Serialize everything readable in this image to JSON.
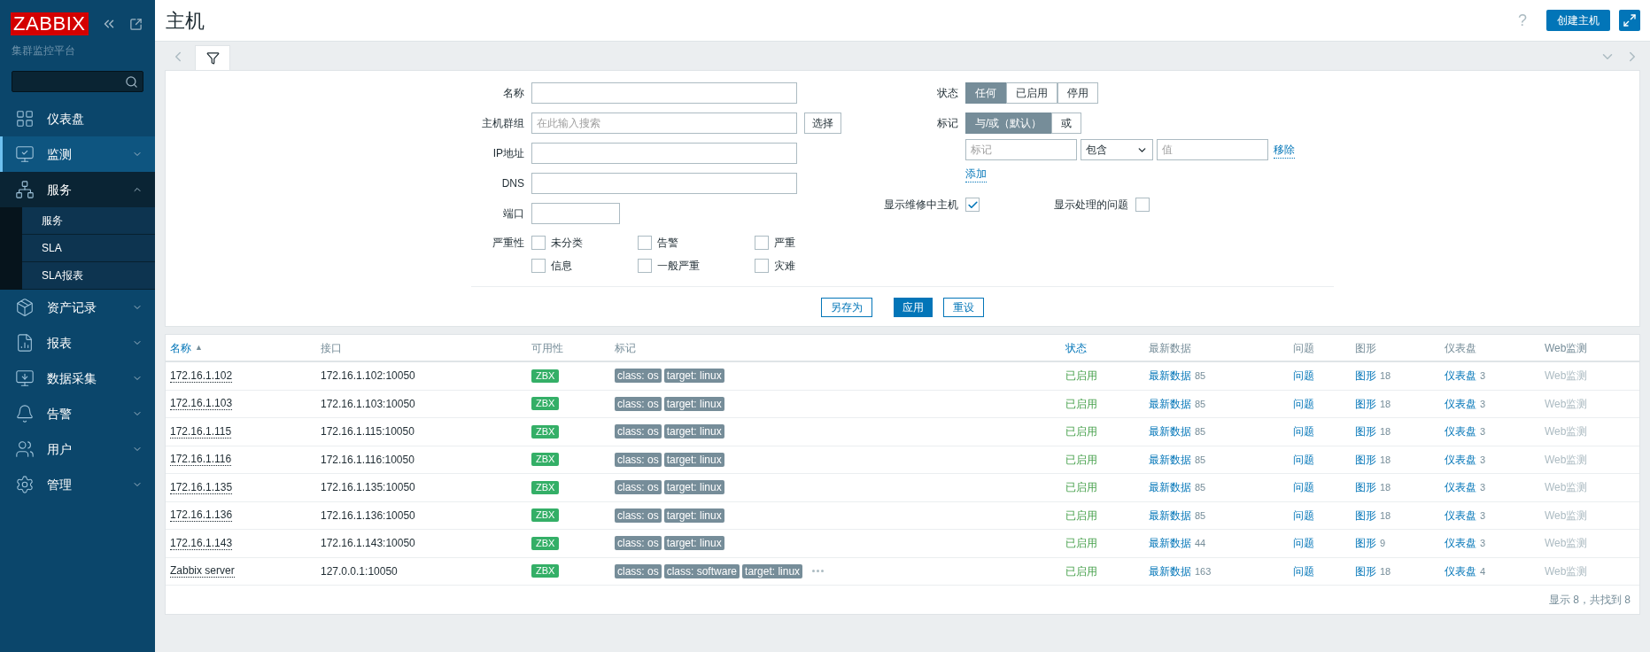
{
  "sidebar": {
    "logo": "ZABBIX",
    "subtitle": "集群监控平台",
    "items": [
      {
        "label": "仪表盘",
        "kind": "link",
        "selected": false
      },
      {
        "label": "监测",
        "kind": "menu",
        "selected": true,
        "expanded": false
      },
      {
        "label": "服务",
        "kind": "menu",
        "selected": false,
        "expanded": true,
        "children": [
          {
            "label": "服务"
          },
          {
            "label": "SLA"
          },
          {
            "label": "SLA报表"
          }
        ]
      },
      {
        "label": "资产记录",
        "kind": "menu",
        "selected": false,
        "expanded": false
      },
      {
        "label": "报表",
        "kind": "menu",
        "selected": false,
        "expanded": false
      },
      {
        "label": "数据采集",
        "kind": "menu",
        "selected": false,
        "expanded": false
      },
      {
        "label": "告警",
        "kind": "menu",
        "selected": false,
        "expanded": false
      },
      {
        "label": "用户",
        "kind": "menu",
        "selected": false,
        "expanded": false
      },
      {
        "label": "管理",
        "kind": "menu",
        "selected": false,
        "expanded": false
      }
    ]
  },
  "header": {
    "title": "主机",
    "help": "?",
    "create_button": "创建主机"
  },
  "filter": {
    "tab_selected": true,
    "fields": [
      {
        "label": "名称"
      },
      {
        "label": "主机群组",
        "placeholder": "在此输入搜索",
        "button": "选择"
      },
      {
        "label": "IP地址"
      },
      {
        "label": "DNS"
      },
      {
        "label": "端口",
        "kind": "short"
      }
    ],
    "severity": {
      "label": "严重性",
      "options": [
        {
          "label": "未分类",
          "checked": false
        },
        {
          "label": "告警",
          "checked": false
        },
        {
          "label": "严重",
          "checked": false
        },
        {
          "label": "信息",
          "checked": false
        },
        {
          "label": "一般严重",
          "checked": false
        },
        {
          "label": "灾难",
          "checked": false
        }
      ]
    },
    "state": {
      "label": "状态",
      "options": [
        {
          "label": "任何",
          "selected": true
        },
        {
          "label": "已启用",
          "selected": false
        },
        {
          "label": "停用",
          "selected": false
        }
      ]
    },
    "tags": {
      "label": "标记",
      "options": [
        {
          "label": "与/或（默认）",
          "selected": true
        },
        {
          "label": "或",
          "selected": false
        }
      ],
      "tag_placeholder": "标记",
      "operator": "包含",
      "value_placeholder": "值",
      "remove": "移除",
      "add": "添加"
    },
    "checks": [
      {
        "label": "显示维修中主机",
        "checked": true
      },
      {
        "label": "显示处理的问题",
        "checked": false
      }
    ],
    "buttons": {
      "save_as": "另存为",
      "apply": "应用",
      "reset": "重设"
    }
  },
  "table": {
    "columns": [
      {
        "label": "名称",
        "sortable": true,
        "sort": "▲"
      },
      {
        "label": "接口",
        "sortable": false
      },
      {
        "label": "可用性",
        "sortable": false
      },
      {
        "label": "标记",
        "sortable": false
      },
      {
        "label": "状态",
        "sortable": true
      },
      {
        "label": "最新数据",
        "sortable": false
      },
      {
        "label": "问题",
        "sortable": false
      },
      {
        "label": "图形",
        "sortable": false
      },
      {
        "label": "仪表盘",
        "sortable": false
      },
      {
        "label": "Web监测",
        "sortable": false
      }
    ],
    "rows": [
      {
        "name": "172.16.1.102",
        "interface": "172.16.1.102:10050",
        "availability": "ZBX",
        "tags": [
          "class: os",
          "target: linux"
        ],
        "status": "已启用",
        "enabled": true,
        "latest": "最新数据",
        "latest_count": "85",
        "problems": "问题",
        "graphs": "图形",
        "graphs_count": "18",
        "dashboards": "仪表盘",
        "dashboards_count": "3",
        "web": "Web监测",
        "web_disabled": true
      },
      {
        "name": "172.16.1.103",
        "interface": "172.16.1.103:10050",
        "availability": "ZBX",
        "tags": [
          "class: os",
          "target: linux"
        ],
        "status": "已启用",
        "enabled": true,
        "latest": "最新数据",
        "latest_count": "85",
        "problems": "问题",
        "graphs": "图形",
        "graphs_count": "18",
        "dashboards": "仪表盘",
        "dashboards_count": "3",
        "web": "Web监测",
        "web_disabled": true
      },
      {
        "name": "172.16.1.115",
        "interface": "172.16.1.115:10050",
        "availability": "ZBX",
        "tags": [
          "class: os",
          "target: linux"
        ],
        "status": "已启用",
        "enabled": true,
        "latest": "最新数据",
        "latest_count": "85",
        "problems": "问题",
        "graphs": "图形",
        "graphs_count": "18",
        "dashboards": "仪表盘",
        "dashboards_count": "3",
        "web": "Web监测",
        "web_disabled": true
      },
      {
        "name": "172.16.1.116",
        "interface": "172.16.1.116:10050",
        "availability": "ZBX",
        "tags": [
          "class: os",
          "target: linux"
        ],
        "status": "已启用",
        "enabled": true,
        "latest": "最新数据",
        "latest_count": "85",
        "problems": "问题",
        "graphs": "图形",
        "graphs_count": "18",
        "dashboards": "仪表盘",
        "dashboards_count": "3",
        "web": "Web监测",
        "web_disabled": true
      },
      {
        "name": "172.16.1.135",
        "interface": "172.16.1.135:10050",
        "availability": "ZBX",
        "tags": [
          "class: os",
          "target: linux"
        ],
        "status": "已启用",
        "enabled": true,
        "latest": "最新数据",
        "latest_count": "85",
        "problems": "问题",
        "graphs": "图形",
        "graphs_count": "18",
        "dashboards": "仪表盘",
        "dashboards_count": "3",
        "web": "Web监测",
        "web_disabled": true
      },
      {
        "name": "172.16.1.136",
        "interface": "172.16.1.136:10050",
        "availability": "ZBX",
        "tags": [
          "class: os",
          "target: linux"
        ],
        "status": "已启用",
        "enabled": true,
        "latest": "最新数据",
        "latest_count": "85",
        "problems": "问题",
        "graphs": "图形",
        "graphs_count": "18",
        "dashboards": "仪表盘",
        "dashboards_count": "3",
        "web": "Web监测",
        "web_disabled": true
      },
      {
        "name": "172.16.1.143",
        "interface": "172.16.1.143:10050",
        "availability": "ZBX",
        "tags": [
          "class: os",
          "target: linux"
        ],
        "status": "已启用",
        "enabled": true,
        "latest": "最新数据",
        "latest_count": "44",
        "problems": "问题",
        "graphs": "图形",
        "graphs_count": "9",
        "dashboards": "仪表盘",
        "dashboards_count": "3",
        "web": "Web监测",
        "web_disabled": true
      },
      {
        "name": "Zabbix server",
        "interface": "127.0.0.1:10050",
        "availability": "ZBX",
        "tags": [
          "class: os",
          "class: software",
          "target: linux"
        ],
        "more_tags": true,
        "status": "已启用",
        "enabled": true,
        "latest": "最新数据",
        "latest_count": "163",
        "problems": "问题",
        "graphs": "图形",
        "graphs_count": "18",
        "dashboards": "仪表盘",
        "dashboards_count": "4",
        "web": "Web监测",
        "web_disabled": true
      }
    ],
    "footer": "显示 8，共找到 8"
  }
}
